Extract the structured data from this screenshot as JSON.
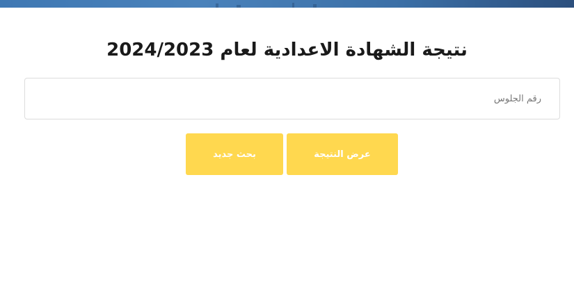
{
  "page": {
    "title": "نتيجة الشهادة الاعدادية لعام 2024/2023"
  },
  "form": {
    "seat_number_placeholder": "رقم الجلوس",
    "seat_number_value": "",
    "show_result_label": "عرض النتيجة",
    "new_search_label": "بحث جديد"
  },
  "colors": {
    "button_bg": "#ffd84f",
    "button_text": "#ffffff",
    "banner": "#3f78b3"
  }
}
